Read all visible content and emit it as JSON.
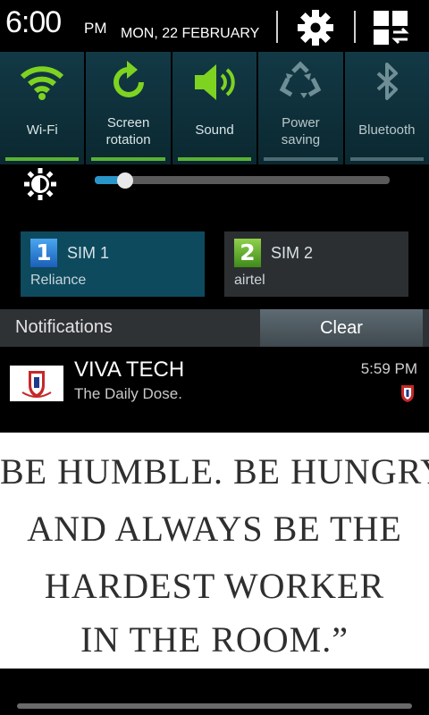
{
  "status": {
    "time": "6:00",
    "ampm": "PM",
    "date": "MON, 22 FEBRUARY"
  },
  "toggles": [
    {
      "label_line1": "Wi-Fi",
      "label_line2": "",
      "icon": "wifi-icon",
      "state": "on"
    },
    {
      "label_line1": "Screen",
      "label_line2": "rotation",
      "icon": "rotation-icon",
      "state": "on"
    },
    {
      "label_line1": "Sound",
      "label_line2": "",
      "icon": "sound-icon",
      "state": "on"
    },
    {
      "label_line1": "Power",
      "label_line2": "saving",
      "icon": "recycle-icon",
      "state": "off"
    },
    {
      "label_line1": "Bluetooth",
      "label_line2": "",
      "icon": "bluetooth-icon",
      "state": "off"
    }
  ],
  "brightness": {
    "level": 0.08
  },
  "sims": [
    {
      "number": "1",
      "name": "SIM 1",
      "operator": "Reliance"
    },
    {
      "number": "2",
      "name": "SIM 2",
      "operator": "airtel"
    }
  ],
  "notifications": {
    "header": "Notifications",
    "clear_label": "Clear",
    "item": {
      "title": "VIVA TECH",
      "subtitle": "The Daily Dose.",
      "time": "5:59 PM"
    }
  },
  "quote": {
    "lines": [
      "BE HUMBLE. BE HUNGRY",
      "AND ALWAYS BE THE",
      "HARDEST WORKER",
      "IN THE ROOM.”"
    ]
  },
  "colors": {
    "toggle_on": "#58b234",
    "toggle_bg": "#0b2830",
    "accent_blue": "#2a95c9"
  }
}
